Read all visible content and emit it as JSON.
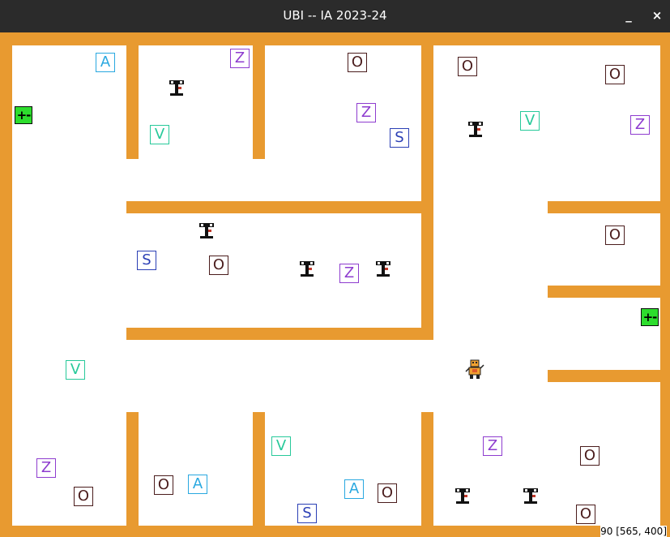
{
  "window": {
    "title": "UBI -- IA 2023-24",
    "minimize_label": "_",
    "close_label": "×"
  },
  "colors": {
    "wall": "#e89a30",
    "titlebar": "#2b2b2b",
    "charger": "#2ddd2d"
  },
  "tiles": {
    "A1": "A",
    "A2": "A",
    "A3": "A",
    "Z1": "Z",
    "Z2": "Z",
    "Z3": "Z",
    "Z4": "Z",
    "Z5": "Z",
    "Z6": "Z",
    "O1": "O",
    "O2": "O",
    "O3": "O",
    "O4": "O",
    "O5": "O",
    "O6": "O",
    "O7": "O",
    "O8": "O",
    "O9": "O",
    "O10": "O",
    "S1": "S",
    "S2": "S",
    "S3": "S",
    "V1": "V",
    "V2": "V",
    "V3": "V",
    "V4": "V"
  },
  "chargers": {
    "c1": "+-",
    "c2": "+-"
  },
  "status": {
    "text": "90  [565, 400]"
  }
}
